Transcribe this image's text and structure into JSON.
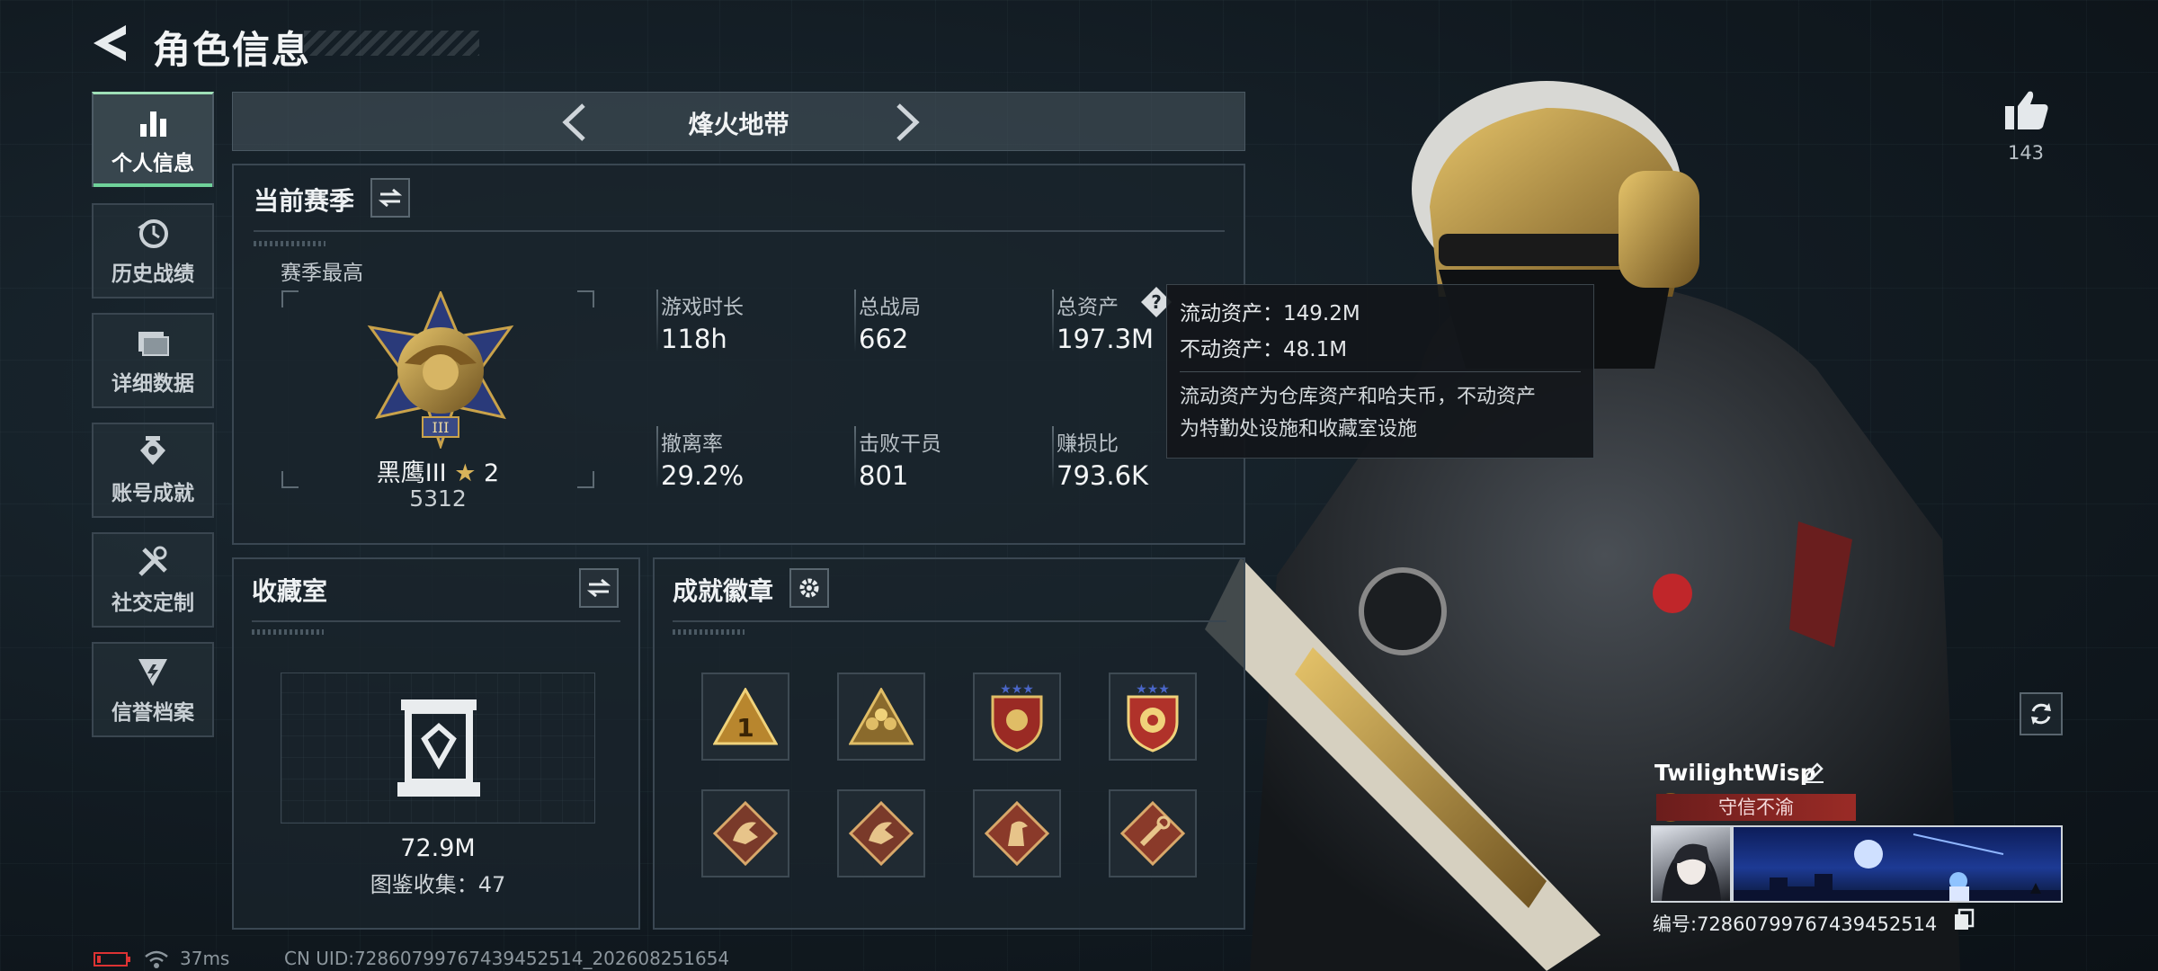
{
  "header": {
    "title": "角色信息"
  },
  "sidebar": {
    "items": [
      {
        "label": "个人信息",
        "icon": "bar-chart-icon",
        "active": true
      },
      {
        "label": "历史战绩",
        "icon": "history-clock-icon",
        "active": false
      },
      {
        "label": "详细数据",
        "icon": "folder-icon",
        "active": false
      },
      {
        "label": "账号成就",
        "icon": "achievement-icon",
        "active": false
      },
      {
        "label": "社交定制",
        "icon": "tools-icon",
        "active": false
      },
      {
        "label": "信誉档案",
        "icon": "credit-shield-icon",
        "active": false
      }
    ]
  },
  "mode": {
    "title": "烽火地带"
  },
  "season": {
    "title": "当前赛季",
    "best_label": "赛季最高",
    "rank_name": "黑鹰III",
    "rank_stars": "2",
    "rank_score": "5312",
    "rank_tier_mark": "III",
    "stats": [
      {
        "label": "游戏时长",
        "value": "118h"
      },
      {
        "label": "总战局",
        "value": "662"
      },
      {
        "label": "总资产",
        "value": "197.3M"
      },
      {
        "label": "撤离率",
        "value": "29.2%"
      },
      {
        "label": "击败干员",
        "value": "801"
      },
      {
        "label": "赚损比",
        "value": "793.6K"
      }
    ]
  },
  "tooltip": {
    "line1": "流动资产：149.2M",
    "line2": "不动资产：48.1M",
    "desc1": "流动资产为仓库资产和哈夫币，不动资产",
    "desc2": "为特勤处设施和收藏室设施"
  },
  "collection": {
    "title": "收藏室",
    "value": "72.9M",
    "count_text": "图鉴收集：47"
  },
  "achievements": {
    "title": "成就徽章",
    "badges": [
      {
        "icon": "gold-triangle-1-icon"
      },
      {
        "icon": "gold-triangle-team-icon"
      },
      {
        "icon": "red-shield-stars-icon"
      },
      {
        "icon": "red-shield-stars-gold-icon"
      },
      {
        "icon": "dragon-diamond-icon"
      },
      {
        "icon": "dragon-diamond-icon-2"
      },
      {
        "icon": "horse-diamond-icon"
      },
      {
        "icon": "wrench-diamond-icon"
      }
    ]
  },
  "likes": {
    "count": "143"
  },
  "profile": {
    "name": "TwilightWisp",
    "title": "守信不渝",
    "uid_text": "编号:7286079976743945251​4"
  },
  "status_bar": {
    "ping": "37ms",
    "uid": "CN UID:7286079976743945251​4_202608251654"
  },
  "colors": {
    "accent_green": "#6fd29a",
    "title_red": "#9a2b26",
    "gold": "#c9a24a"
  }
}
